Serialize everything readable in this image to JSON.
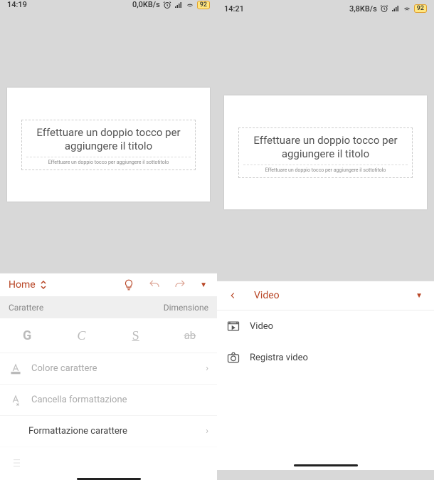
{
  "left": {
    "status": {
      "time": "14:19",
      "net": "0,0KB/s",
      "battery": "92"
    },
    "slide": {
      "title": "Effettuare un doppio tocco per aggiungere il titolo",
      "subtitle": "Effettuare un doppio tocco per aggiungere il sottotitolo"
    },
    "toolbar": {
      "tab": "Home"
    },
    "section": {
      "left": "Carattere",
      "right": "Dimensione"
    },
    "fmt": {
      "bold": "G",
      "italic": "C",
      "under": "S",
      "strike": "ab"
    },
    "rows": {
      "color": "Colore carattere",
      "clear": "Cancella formattazione",
      "charfmt": "Formattazione carattere"
    }
  },
  "right": {
    "status": {
      "time": "14:21",
      "net": "3,8KB/s",
      "battery": "92"
    },
    "slide": {
      "title": "Effettuare un doppio tocco per aggiungere il titolo",
      "subtitle": "Effettuare un doppio tocco per aggiungere il sottotitolo"
    },
    "toolbar": {
      "tab": "Video"
    },
    "rows": {
      "video": "Video",
      "record": "Registra video"
    }
  }
}
